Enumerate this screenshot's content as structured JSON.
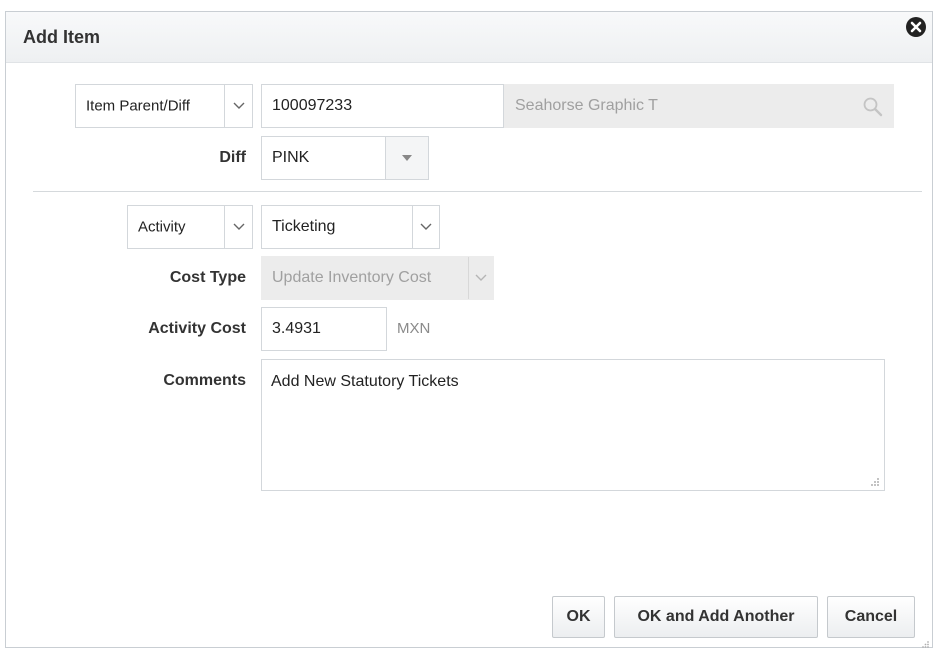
{
  "dialog": {
    "title": "Add Item"
  },
  "item_type_select": {
    "value": "Item Parent/Diff"
  },
  "item_number": {
    "value": "100097233"
  },
  "item_description": {
    "value": "Seahorse Graphic T"
  },
  "diff": {
    "label": "Diff",
    "value": "PINK"
  },
  "activity_type_select": {
    "value": "Activity"
  },
  "activity_select": {
    "value": "Ticketing"
  },
  "cost_type": {
    "label": "Cost Type",
    "value": "Update Inventory Cost"
  },
  "activity_cost": {
    "label": "Activity Cost",
    "value": "3.4931",
    "currency": "MXN"
  },
  "comments": {
    "label": "Comments",
    "value": "Add New Statutory Tickets"
  },
  "buttons": {
    "ok": "OK",
    "ok_add_another": "OK and Add Another",
    "cancel": "Cancel"
  },
  "colors": {
    "text": "#333333",
    "border": "#d3d7db",
    "disabled": "#ececec",
    "close": "#222222"
  }
}
